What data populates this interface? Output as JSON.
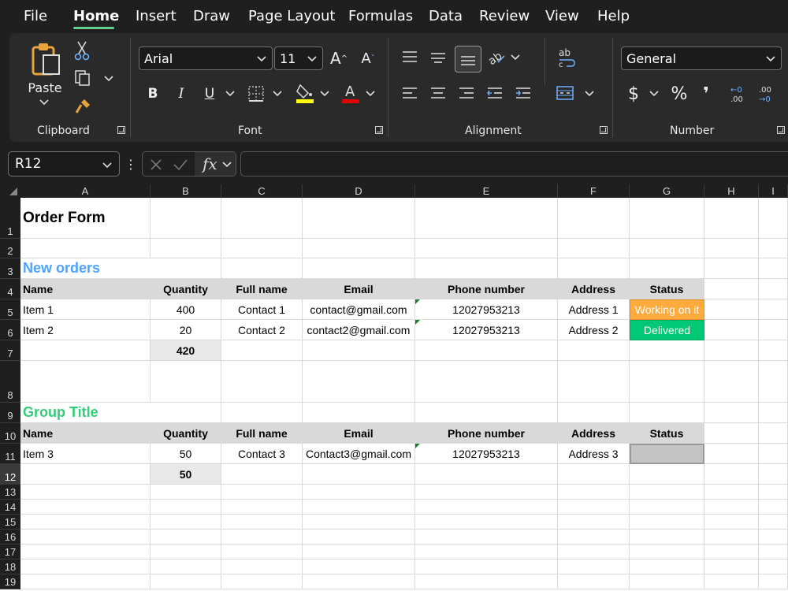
{
  "menu": {
    "file": "File",
    "home": "Home",
    "insert": "Insert",
    "draw": "Draw",
    "page_layout": "Page Layout",
    "formulas": "Formulas",
    "data": "Data",
    "review": "Review",
    "view": "View",
    "help": "Help"
  },
  "ribbon": {
    "paste_label": "Paste",
    "clipboard_label": "Clipboard",
    "font_name": "Arial",
    "font_size": "11",
    "font_label": "Font",
    "alignment_label": "Alignment",
    "number_format": "General",
    "number_label": "Number",
    "bold": "B",
    "italic": "I",
    "underline": "U",
    "currency": "$",
    "percent": "%",
    "comma": "❜",
    "fill_color": "#ffff00",
    "font_color": "#e00000"
  },
  "formula_bar": {
    "name_box": "R12",
    "fx": "fx"
  },
  "columns": [
    "A",
    "B",
    "C",
    "D",
    "E",
    "F",
    "G",
    "H",
    "I"
  ],
  "rows": [
    "1",
    "2",
    "3",
    "4",
    "5",
    "6",
    "7",
    "8",
    "9",
    "10",
    "11",
    "12",
    "13",
    "14",
    "15",
    "16",
    "17",
    "18",
    "19"
  ],
  "sheet": {
    "title": "Order Form",
    "group1_title": "New orders",
    "group1_color": "#4da3ff",
    "group2_title": "Group Title",
    "group2_color": "#33cc77",
    "headers": [
      "Name",
      "Quantity",
      "Full name",
      "Email",
      "Phone number",
      "Address",
      "Status"
    ],
    "group1_rows": [
      [
        "Item 1",
        "400",
        "Contact 1",
        "contact@gmail.com",
        "12027953213",
        "Address 1",
        "Working on it"
      ],
      [
        "Item 2",
        "20",
        "Contact 2",
        "contact2@gmail.com",
        "12027953213",
        "Address 2",
        "Delivered"
      ]
    ],
    "group1_total": "420",
    "group2_rows": [
      [
        "Item 3",
        "50",
        "Contact 3",
        "Contact3@gmail.com",
        "12027953213",
        "Address 3",
        ""
      ]
    ],
    "group2_total": "50",
    "status_colors": {
      "working": "#fdab3d",
      "delivered": "#00c875",
      "empty": "#c4c4c4"
    }
  }
}
